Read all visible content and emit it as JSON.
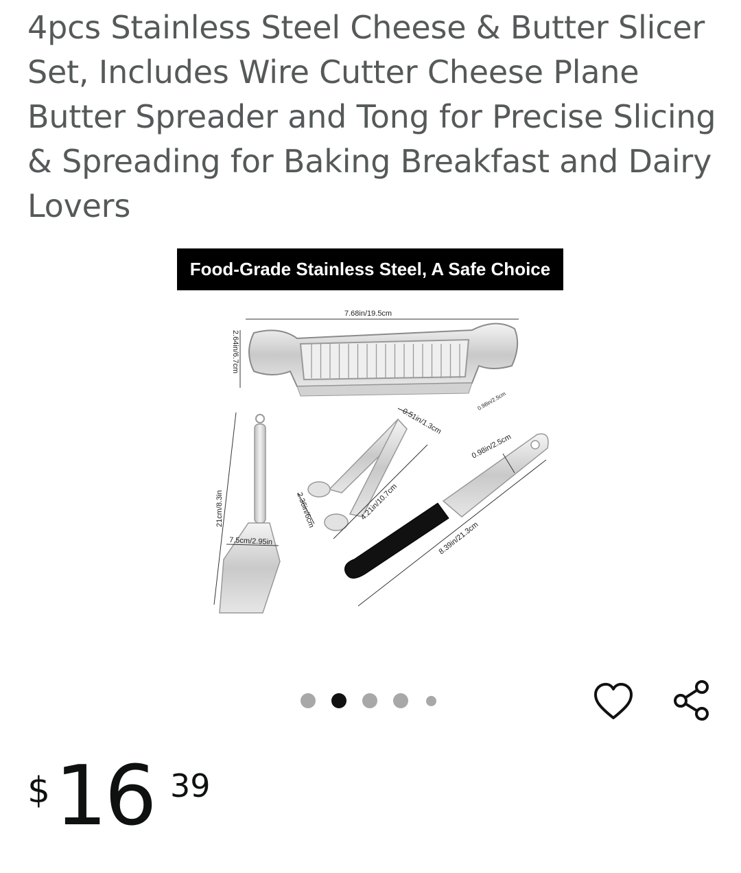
{
  "product": {
    "title": "4pcs Stainless Steel Cheese & Butter Slicer Set, Includes Wire Cutter Cheese Plane Butter Spreader and Tong for Precise Slicing & Spreading for Baking Breakfast and Dairy Lovers"
  },
  "gallery": {
    "banner_text": "Food-Grade Stainless Steel, A Safe Choice",
    "dimensions": {
      "slicer_length": "7.68in/19.5cm",
      "slicer_height": "2.64in/6.7cm",
      "slicer_depth": "0.98in/2.5cm",
      "tong_width": "0.51in/1.3cm",
      "tong_length": "4.21in/10.7cm",
      "tong_height": "2.36in/6cm",
      "plane_length": "21cm/8.3in",
      "plane_width": "7.5cm/2.95in",
      "spreader_width": "0.98in/2.5cm",
      "spreader_length": "8.39in/21.3cm"
    },
    "image_count": 5,
    "active_index": 1
  },
  "actions": {
    "favorite_icon": "heart-icon",
    "share_icon": "share-icon"
  },
  "price": {
    "currency_symbol": "$",
    "whole": "16",
    "fraction": "39"
  }
}
